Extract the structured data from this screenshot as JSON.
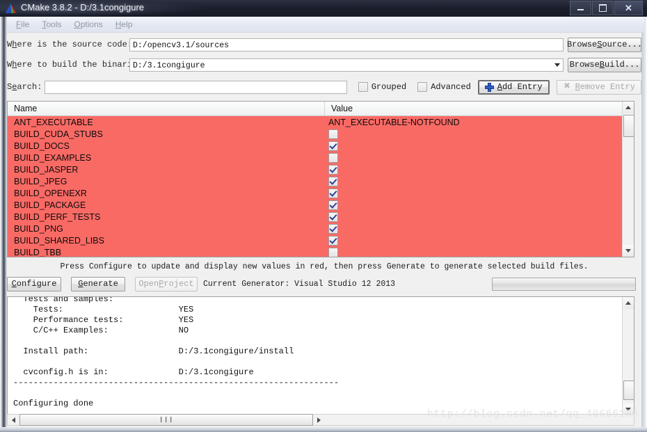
{
  "window": {
    "title": "CMake 3.8.2 - D:/3.1congigure",
    "logo_icon": "cmake-triangle-logo",
    "minimize_label": "–",
    "maximize_label": "□",
    "close_label": "✕"
  },
  "menu": {
    "items": [
      {
        "label": "File",
        "mnemonic": "F"
      },
      {
        "label": "Tools",
        "mnemonic": "T"
      },
      {
        "label": "Options",
        "mnemonic": "O"
      },
      {
        "label": "Help",
        "mnemonic": "H"
      }
    ]
  },
  "paths": {
    "source_label": "Where is the source code:",
    "source_value": "D:/opencv3.1/sources",
    "browse_source_label": "Browse Source...",
    "build_label": "Where to build the binaries:",
    "build_value": "D:/3.1congigure",
    "browse_build_label": "Browse Build..."
  },
  "search": {
    "label": "Search:",
    "value": "",
    "placeholder": "",
    "grouped_label": "Grouped",
    "grouped_checked": false,
    "advanced_label": "Advanced",
    "advanced_checked": false,
    "add_entry_label": "Add Entry",
    "add_entry_icon": "plus-icon",
    "remove_entry_label": "Remove Entry",
    "remove_entry_icon": "x-icon",
    "remove_entry_enabled": false
  },
  "cache_table": {
    "columns": [
      "Name",
      "Value"
    ],
    "rows": [
      {
        "name": "ANT_EXECUTABLE",
        "type": "text",
        "value": "ANT_EXECUTABLE-NOTFOUND"
      },
      {
        "name": "BUILD_CUDA_STUBS",
        "type": "checkbox",
        "checked": false
      },
      {
        "name": "BUILD_DOCS",
        "type": "checkbox",
        "checked": true
      },
      {
        "name": "BUILD_EXAMPLES",
        "type": "checkbox",
        "checked": false
      },
      {
        "name": "BUILD_JASPER",
        "type": "checkbox",
        "checked": true
      },
      {
        "name": "BUILD_JPEG",
        "type": "checkbox",
        "checked": true
      },
      {
        "name": "BUILD_OPENEXR",
        "type": "checkbox",
        "checked": true
      },
      {
        "name": "BUILD_PACKAGE",
        "type": "checkbox",
        "checked": true
      },
      {
        "name": "BUILD_PERF_TESTS",
        "type": "checkbox",
        "checked": true
      },
      {
        "name": "BUILD_PNG",
        "type": "checkbox",
        "checked": true
      },
      {
        "name": "BUILD_SHARED_LIBS",
        "type": "checkbox",
        "checked": true
      },
      {
        "name": "BUILD_TBB",
        "type": "checkbox",
        "checked": false
      }
    ],
    "row_highlight_color": "#fa6a65"
  },
  "status": {
    "hint": "Press Configure to update and display new values in red, then press Generate to generate selected build files.",
    "configure_label": "Configure",
    "generate_label": "Generate",
    "open_project_label": "Open Project",
    "open_project_enabled": false,
    "generator_text": "Current Generator: Visual Studio 12 2013",
    "progress_percent": 0
  },
  "output": {
    "lines": [
      "  Tests and samples:",
      "    Tests:                       YES",
      "    Performance tests:           YES",
      "    C/C++ Examples:              NO",
      "",
      "  Install path:                  D:/3.1congigure/install",
      "",
      "  cvconfig.h is in:              D:/3.1congigure",
      "-----------------------------------------------------------------",
      "",
      "Configuring done"
    ]
  },
  "scrollbars": {
    "grip_glyph": "❙❙❙",
    "up_arrow": "up-arrow-icon",
    "down_arrow": "down-arrow-icon",
    "left_arrow": "left-arrow-icon",
    "right_arrow": "right-arrow-icon"
  },
  "watermark": {
    "text": "http://blog.csdn.net/qq_40666136"
  }
}
